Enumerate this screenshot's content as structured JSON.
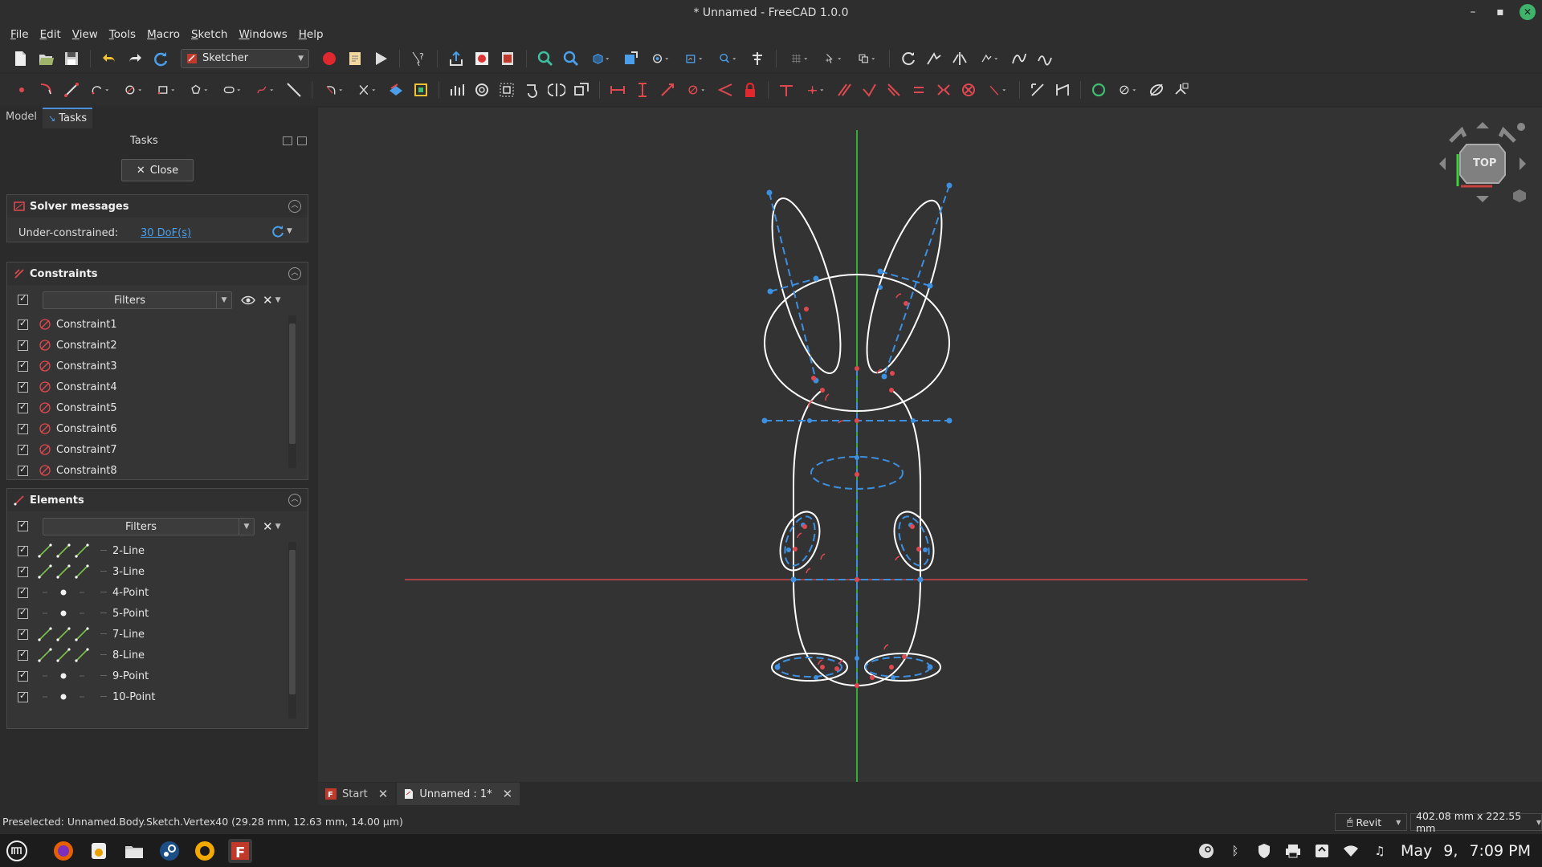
{
  "window": {
    "title": "* Unnamed - FreeCAD 1.0.0"
  },
  "menu": [
    "File",
    "Edit",
    "View",
    "Tools",
    "Macro",
    "Sketch",
    "Windows",
    "Help"
  ],
  "workbench": {
    "selected": "Sketcher"
  },
  "panel": {
    "tabs": [
      "Model",
      "Tasks"
    ],
    "title": "Tasks",
    "close_label": "Close",
    "solver": {
      "title": "Solver messages",
      "status_label": "Under-constrained:",
      "dof_link": "30 DoF(s)"
    },
    "constraints": {
      "title": "Constraints",
      "filter_label": "Filters",
      "items": [
        "Constraint1",
        "Constraint2",
        "Constraint3",
        "Constraint4",
        "Constraint5",
        "Constraint6",
        "Constraint7",
        "Constraint8"
      ]
    },
    "elements": {
      "title": "Elements",
      "filter_label": "Filters",
      "items": [
        {
          "label": "2-Line",
          "kind": "line"
        },
        {
          "label": "3-Line",
          "kind": "line"
        },
        {
          "label": "4-Point",
          "kind": "point"
        },
        {
          "label": "5-Point",
          "kind": "point"
        },
        {
          "label": "7-Line",
          "kind": "line"
        },
        {
          "label": "8-Line",
          "kind": "line"
        },
        {
          "label": "9-Point",
          "kind": "point"
        },
        {
          "label": "10-Point",
          "kind": "point"
        }
      ]
    }
  },
  "navcube": {
    "face": "TOP"
  },
  "doc_tabs": [
    "Start",
    "Unnamed : 1*"
  ],
  "status": {
    "message": "Preselected: Unnamed.Body.Sketch.Vertex40 (29.28 mm, 12.63 mm, 14.00 µm)",
    "nav_style": "Revit",
    "dimensions": "402.08 mm x 222.55 mm"
  },
  "clock": {
    "date_month": "May",
    "date_day": "9,",
    "time": "7:09 PM"
  },
  "colors": {
    "accent_blue": "#4a9eea",
    "sketch_white": "#ffffff",
    "construction_blue": "#3d8fe0",
    "constraint_red": "#e0484f",
    "x_axis": "#d0474a",
    "y_axis": "#3ad13a"
  }
}
